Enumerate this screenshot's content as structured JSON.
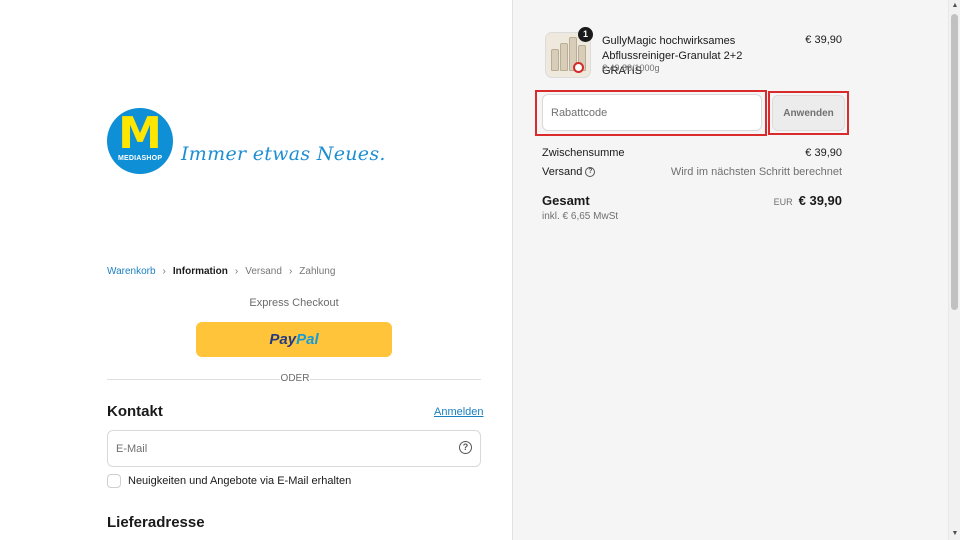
{
  "brand": {
    "logo_letter": "M",
    "logo_band": "MEDIASHOP",
    "tagline": "Immer etwas Neues."
  },
  "breadcrumb": [
    {
      "label": "Warenkorb",
      "state": "link"
    },
    {
      "label": "Information",
      "state": "current"
    },
    {
      "label": "Versand",
      "state": "upcoming"
    },
    {
      "label": "Zahlung",
      "state": "upcoming"
    }
  ],
  "express": {
    "label": "Express Checkout",
    "paypal_part1": "Pay",
    "paypal_part2": "Pal",
    "divider_text": "ODER"
  },
  "contact": {
    "title": "Kontakt",
    "login_link": "Anmelden",
    "email_placeholder": "E-Mail",
    "email_value": "",
    "newsletter_label": "Neuigkeiten und Angebote via E-Mail erhalten",
    "newsletter_checked": false
  },
  "shipping_address": {
    "title": "Lieferadresse"
  },
  "summary": {
    "product": {
      "quantity": "1",
      "name": "GullyMagic hochwirksames Abflussreiniger-Granulat 2+2 GRATIS",
      "unit_price": "€ 49,88/1000g",
      "price": "€ 39,90"
    },
    "discount": {
      "placeholder": "Rabattcode",
      "value": "",
      "apply_label": "Anwenden"
    },
    "subtotal_label": "Zwischensumme",
    "subtotal_value": "€ 39,90",
    "shipping_label": "Versand",
    "shipping_value": "Wird im nächsten Schritt berechnet",
    "total_label": "Gesamt",
    "total_currency": "EUR",
    "total_value": "€ 39,90",
    "tax_line": "inkl. € 6,65 MwSt"
  },
  "colors": {
    "accent_link": "#1a7fbf",
    "paypal_yellow": "#ffc439",
    "highlight_red": "#d92b2b",
    "logo_blue": "#0f8fd6",
    "logo_yellow": "#ffe600"
  }
}
